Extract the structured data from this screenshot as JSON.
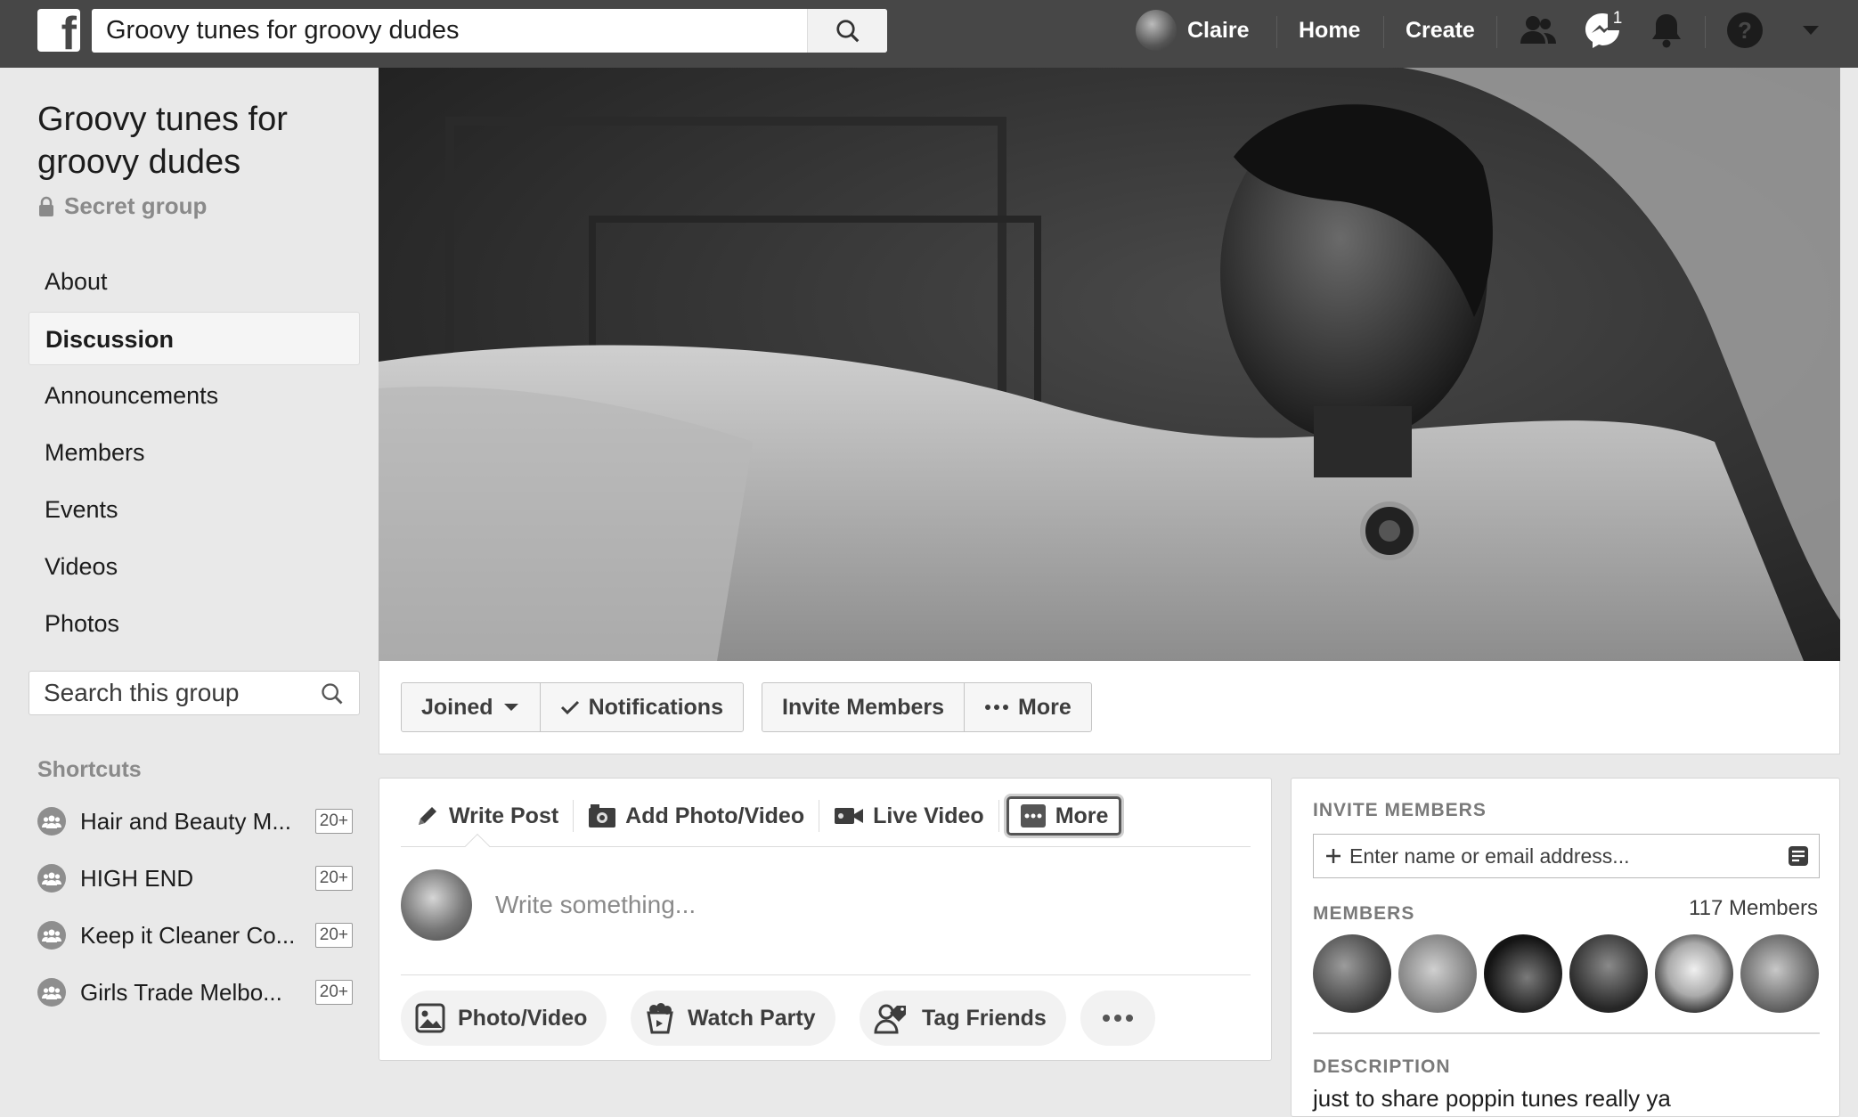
{
  "topbar": {
    "logo": "f",
    "search_value": "Groovy tunes for groovy dudes",
    "profile_name": "Claire",
    "home": "Home",
    "create": "Create",
    "messages_badge": "1"
  },
  "group": {
    "title": "Groovy tunes for groovy dudes",
    "privacy": "Secret group"
  },
  "sidebar": {
    "items": [
      {
        "label": "About"
      },
      {
        "label": "Discussion"
      },
      {
        "label": "Announcements"
      },
      {
        "label": "Members"
      },
      {
        "label": "Events"
      },
      {
        "label": "Videos"
      },
      {
        "label": "Photos"
      }
    ],
    "search_placeholder": "Search this group",
    "shortcuts_heading": "Shortcuts",
    "shortcuts": [
      {
        "label": "Hair and Beauty M...",
        "count": "20+"
      },
      {
        "label": "HIGH END",
        "count": "20+"
      },
      {
        "label": "Keep it Cleaner Co...",
        "count": "20+"
      },
      {
        "label": "Girls Trade Melbo...",
        "count": "20+"
      }
    ]
  },
  "actions": {
    "joined": "Joined",
    "notifications": "Notifications",
    "invite_members": "Invite Members",
    "more": "More"
  },
  "composer": {
    "tabs": {
      "write_post": "Write Post",
      "add_photo": "Add Photo/Video",
      "live_video": "Live Video",
      "more": "More"
    },
    "placeholder": "Write something...",
    "pills": {
      "photo_video": "Photo/Video",
      "watch_party": "Watch Party",
      "tag_friends": "Tag Friends"
    }
  },
  "right_panel": {
    "invite_heading": "INVITE MEMBERS",
    "invite_placeholder": "Enter name or email address...",
    "members_heading": "MEMBERS",
    "members_count": "117 Members",
    "description_heading": "DESCRIPTION",
    "description": "just to share poppin tunes really ya"
  },
  "colors": {
    "topbar": "#474747",
    "background": "#e9e9e9",
    "panel": "#ffffff"
  }
}
